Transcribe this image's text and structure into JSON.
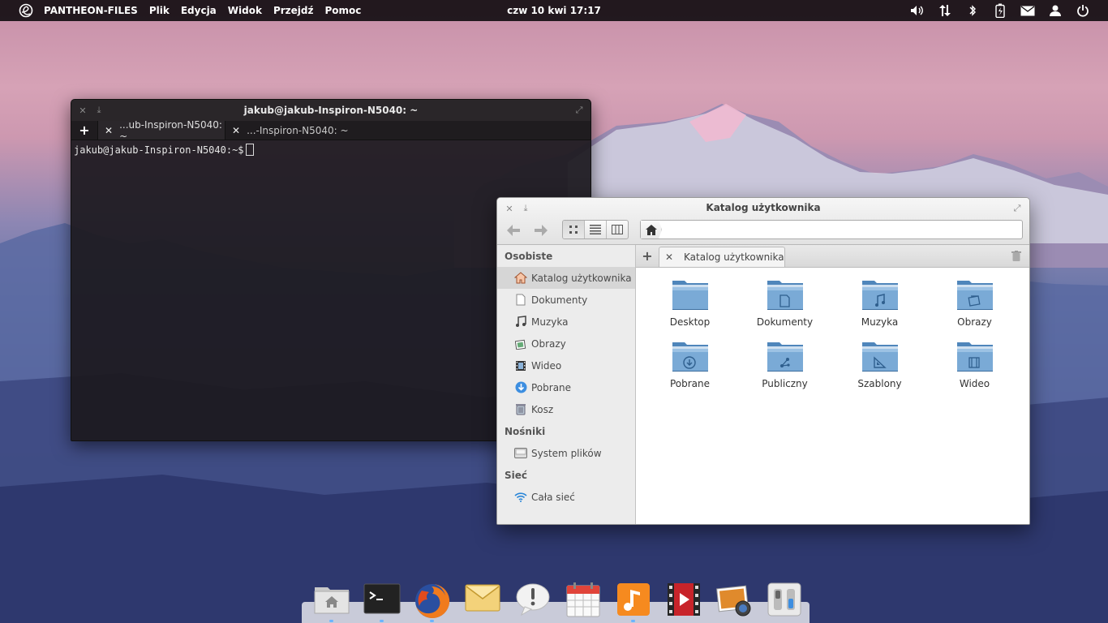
{
  "panel": {
    "app_name": "PANTHEON-FILES",
    "menus": [
      "Plik",
      "Edycja",
      "Widok",
      "Przejdź",
      "Pomoc"
    ],
    "clock": "czw 10 kwi 17:17",
    "indicators": [
      "volume-icon",
      "network-icon",
      "bluetooth-icon",
      "battery-icon",
      "mail-icon",
      "user-icon",
      "power-icon"
    ]
  },
  "terminal": {
    "title": "jakub@jakub-Inspiron-N5040: ~",
    "tabs": [
      {
        "label": "...ub-Inspiron-N5040: ~"
      },
      {
        "label": "...-Inspiron-N5040: ~"
      }
    ],
    "prompt": "jakub@jakub-Inspiron-N5040:~$"
  },
  "files": {
    "title": "Katalog użytkownika",
    "tab_label": "Katalog użytkownika",
    "sidebar": {
      "personal_header": "Osobiste",
      "personal": [
        {
          "label": "Katalog użytkownika",
          "icon": "home-icon"
        },
        {
          "label": "Dokumenty",
          "icon": "document-icon"
        },
        {
          "label": "Muzyka",
          "icon": "music-icon"
        },
        {
          "label": "Obrazy",
          "icon": "image-icon"
        },
        {
          "label": "Wideo",
          "icon": "video-icon"
        },
        {
          "label": "Pobrane",
          "icon": "download-icon"
        },
        {
          "label": "Kosz",
          "icon": "trash-icon"
        }
      ],
      "devices_header": "Nośniki",
      "devices": [
        {
          "label": "System plików",
          "icon": "drive-icon"
        }
      ],
      "network_header": "Sieć",
      "network": [
        {
          "label": "Cała sieć",
          "icon": "network-icon"
        }
      ]
    },
    "folders": [
      {
        "label": "Desktop",
        "icon": "none"
      },
      {
        "label": "Dokumenty",
        "icon": "document"
      },
      {
        "label": "Muzyka",
        "icon": "music"
      },
      {
        "label": "Obrazy",
        "icon": "image"
      },
      {
        "label": "Pobrane",
        "icon": "download"
      },
      {
        "label": "Publiczny",
        "icon": "share"
      },
      {
        "label": "Szablony",
        "icon": "template"
      },
      {
        "label": "Wideo",
        "icon": "video"
      }
    ]
  },
  "dock": {
    "apps": [
      {
        "name": "files",
        "running": true
      },
      {
        "name": "terminal",
        "running": true
      },
      {
        "name": "firefox",
        "running": true
      },
      {
        "name": "mail",
        "running": false
      },
      {
        "name": "notes",
        "running": false
      },
      {
        "name": "calendar",
        "running": false
      },
      {
        "name": "music",
        "running": true
      },
      {
        "name": "videos",
        "running": false
      },
      {
        "name": "photos",
        "running": false
      },
      {
        "name": "settings",
        "running": false
      }
    ]
  },
  "colors": {
    "folder": "#7aaad6",
    "folder_dark": "#4f86bb",
    "panel_bg": "#140e12",
    "accent": "#6ab4ff"
  }
}
